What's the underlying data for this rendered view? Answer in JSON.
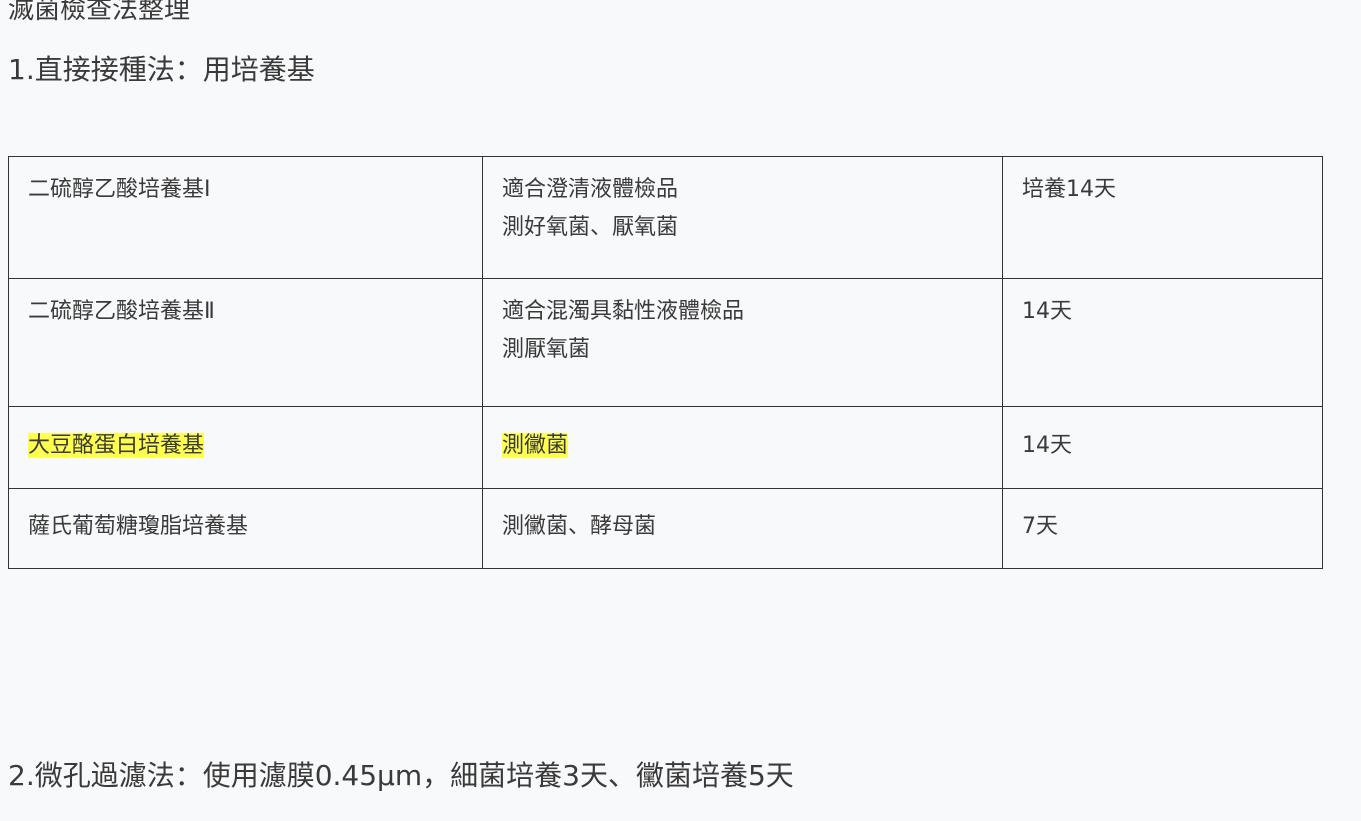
{
  "doc": {
    "title": "滅菌檢查法整理",
    "heading1": "1.直接接種法：用培養基",
    "heading2": "2.微孔過濾法：使用濾膜0.45μm，細菌培養3天、黴菌培養5天"
  },
  "table": {
    "rows": [
      {
        "medium": "二硫醇乙酸培養基Ⅰ",
        "use_line1": "適合澄清液體檢品",
        "use_line2": "測好氧菌、厭氧菌",
        "days": "培養14天"
      },
      {
        "medium": "二硫醇乙酸培養基Ⅱ",
        "use_line1": "適合混濁具黏性液體檢品",
        "use_line2": "測厭氧菌",
        "days": "14天"
      },
      {
        "medium": "大豆酪蛋白培養基",
        "use_line1": "測黴菌",
        "days": "14天"
      },
      {
        "medium": "薩氏葡萄糖瓊脂培養基",
        "use_line1": "測黴菌、酵母菌",
        "days": "7天"
      }
    ]
  },
  "colors": {
    "highlight": "#ffff4d",
    "border": "#333333",
    "background": "#f8f9fb"
  }
}
